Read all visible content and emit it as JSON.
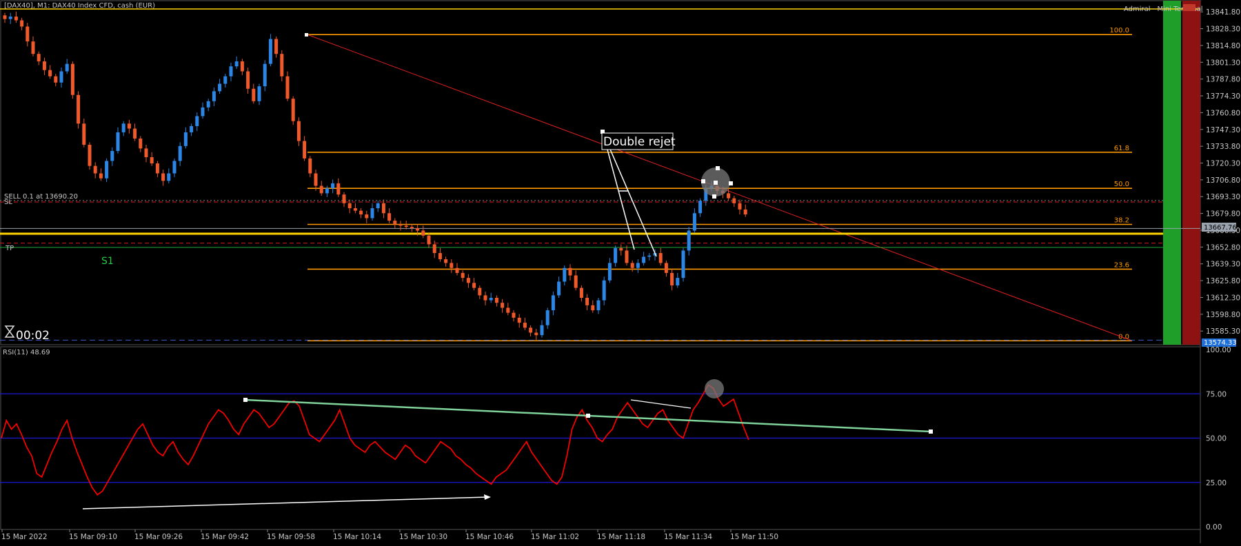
{
  "header": {
    "title": "[DAX40], M1:  DAX40 Index CFD, cash (EUR)"
  },
  "top_right": {
    "label": "Admiral - Mini Terminal"
  },
  "trade": {
    "sell_label": "SELL 0.1 at 13690.20",
    "sl_label": "SL",
    "tp_label": "TP",
    "s1_label": "S1"
  },
  "timer": {
    "value": "00:02"
  },
  "annotation": {
    "text": "Double rejet"
  },
  "price_tags": {
    "current": "13667.76",
    "bottom": "13574.33"
  },
  "colors": {
    "bull": "#2b86e6",
    "bear": "#f0592a",
    "fib": "#ff9900",
    "rsi": "#ff0000",
    "trend": "#7fd39a"
  },
  "price_axis": [
    "13841.80",
    "13828.30",
    "13814.80",
    "13801.30",
    "13787.80",
    "13774.30",
    "13760.80",
    "13747.30",
    "13733.80",
    "13720.30",
    "13706.80",
    "13693.30",
    "13679.80",
    "13666.30",
    "13652.80",
    "13639.30",
    "13625.80",
    "13612.30",
    "13598.80",
    "13585.30"
  ],
  "fib_levels": [
    {
      "label": "100.0",
      "price": 13823.5
    },
    {
      "label": "61.8",
      "price": 13729.0
    },
    {
      "label": "50.0",
      "price": 13700.0
    },
    {
      "label": "38.2",
      "price": 13671.0
    },
    {
      "label": "23.6",
      "price": 13635.0
    },
    {
      "label": "0.0",
      "price": 13577.5
    }
  ],
  "time_axis": [
    "15 Mar 2022",
    "15 Mar 09:10",
    "15 Mar 09:26",
    "15 Mar 09:42",
    "15 Mar 09:58",
    "15 Mar 10:14",
    "15 Mar 10:30",
    "15 Mar 10:46",
    "15 Mar 11:02",
    "15 Mar 11:18",
    "15 Mar 11:34",
    "15 Mar 11:50"
  ],
  "rsi": {
    "label": "RSI(11) 48.69",
    "axis": [
      "100.00",
      "75.00",
      "50.00",
      "25.00",
      "0.00"
    ],
    "levels": [
      75,
      50,
      25
    ]
  },
  "chart_data": {
    "type": "candlestick",
    "symbol": "DAX40",
    "timeframe": "M1",
    "ylim": [
      13574.33,
      13848.0
    ],
    "close_series": [
      13836,
      13838,
      13835,
      13830,
      13818,
      13808,
      13802,
      13795,
      13790,
      13785,
      13794,
      13800,
      13775,
      13752,
      13735,
      13718,
      13712,
      13708,
      13722,
      13730,
      13745,
      13752,
      13748,
      13740,
      13732,
      13725,
      13720,
      13712,
      13706,
      13712,
      13722,
      13734,
      13745,
      13750,
      13758,
      13765,
      13770,
      13778,
      13784,
      13790,
      13798,
      13802,
      13794,
      13780,
      13770,
      13782,
      13800,
      13820,
      13808,
      13790,
      13772,
      13754,
      13738,
      13724,
      13712,
      13702,
      13696,
      13700,
      13704,
      13695,
      13688,
      13684,
      13682,
      13679,
      13676,
      13684,
      13688,
      13680,
      13674,
      13671,
      13670,
      13669,
      13668,
      13666,
      13662,
      13655,
      13648,
      13643,
      13640,
      13636,
      13632,
      13628,
      13624,
      13620,
      13614,
      13610,
      13612,
      13608,
      13604,
      13600,
      13596,
      13592,
      13588,
      13584,
      13582,
      13590,
      13602,
      13614,
      13625,
      13636,
      13630,
      13620,
      13612,
      13606,
      13602,
      13610,
      13626,
      13640,
      13652,
      13650,
      13640,
      13636,
      13640,
      13645,
      13646,
      13648,
      13640,
      13632,
      13622,
      13628,
      13650,
      13666,
      13680,
      13690,
      13700,
      13702,
      13698,
      13696,
      13692,
      13688,
      13683,
      13679
    ],
    "x_labels": [
      "15 Mar 2022",
      "15 Mar 09:10",
      "15 Mar 09:26",
      "15 Mar 09:42",
      "15 Mar 09:58",
      "15 Mar 10:14",
      "15 Mar 10:30",
      "15 Mar 10:46",
      "15 Mar 11:02",
      "15 Mar 11:18",
      "15 Mar 11:34",
      "15 Mar 11:50"
    ],
    "lines": [
      {
        "name": "SELL",
        "price": 13690.2
      },
      {
        "name": "SL",
        "price": 13689.0
      },
      {
        "name": "TP",
        "price": 13656.0
      },
      {
        "name": "S1",
        "price": 13652.5
      },
      {
        "name": "current",
        "price": 13667.76
      }
    ],
    "rsi_values": [
      50,
      60,
      55,
      58,
      52,
      45,
      40,
      30,
      28,
      35,
      42,
      48,
      55,
      60,
      50,
      42,
      35,
      28,
      22,
      18,
      20,
      25,
      30,
      35,
      40,
      45,
      50,
      55,
      58,
      52,
      46,
      42,
      40,
      45,
      48,
      42,
      38,
      35,
      40,
      46,
      52,
      58,
      62,
      66,
      64,
      60,
      55,
      52,
      58,
      62,
      66,
      64,
      60,
      56,
      58,
      62,
      66,
      70,
      71,
      68,
      60,
      52,
      50,
      48,
      52,
      56,
      60,
      66,
      58,
      50,
      46,
      44,
      42,
      46,
      48,
      45,
      42,
      40,
      38,
      42,
      46,
      44,
      40,
      38,
      36,
      40,
      44,
      48,
      46,
      44,
      40,
      38,
      35,
      33,
      30,
      28,
      26,
      24,
      28,
      30,
      32,
      36,
      40,
      44,
      48,
      42,
      38,
      34,
      30,
      26,
      24,
      28,
      40,
      55,
      62,
      66,
      60,
      56,
      50,
      48,
      52,
      55,
      62,
      66,
      70,
      66,
      62,
      58,
      56,
      60,
      64,
      66,
      60,
      56,
      52,
      50,
      58,
      66,
      70,
      75,
      80,
      78,
      72,
      68,
      70,
      72,
      64,
      56,
      49
    ],
    "rsi_ylim": [
      0,
      100
    ]
  }
}
